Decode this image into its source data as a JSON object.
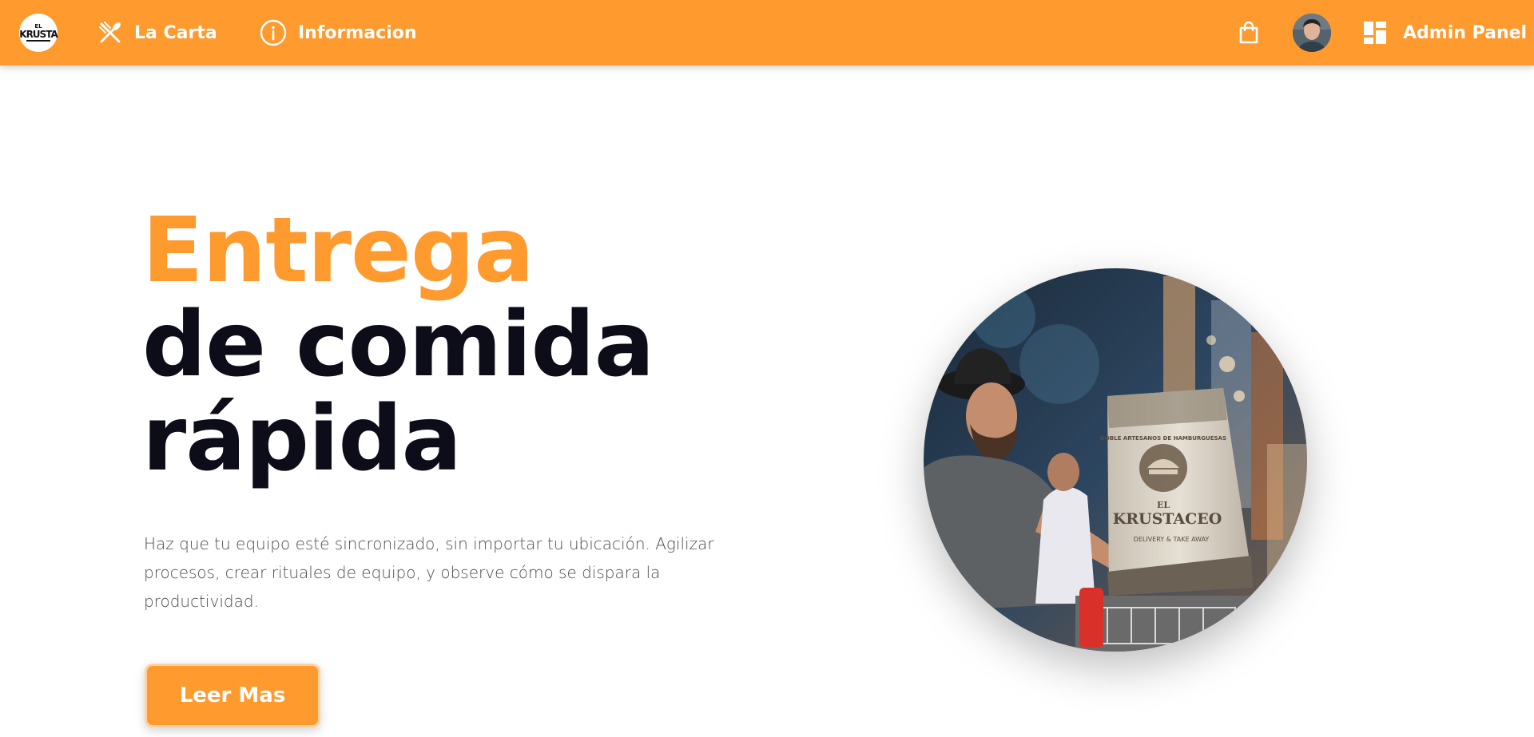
{
  "brand": {
    "logo_top": "EL",
    "logo_main": "KRUSTA"
  },
  "nav": {
    "carta_label": "La Carta",
    "info_label": "Informacion",
    "admin_label": "Admin Panel"
  },
  "icons": {
    "carta": "fork-knife-icon",
    "info": "info-circle-icon",
    "cart": "shopping-bag-icon",
    "admin": "dashboard-icon"
  },
  "hero": {
    "title_accent": "Entrega",
    "title_line2": "de comida",
    "title_line3": "rápida",
    "description": "Haz que tu equipo esté sincronizado, sin importar tu ubicación. Agilizar procesos, crear rituales de equipo, y observe cómo se dispara la productividad.",
    "cta_label": "Leer Mas"
  },
  "photo": {
    "bag_small_text": "DOBLE ARTESANOS DE HAMBURGUESAS",
    "bag_brand_1": "EL",
    "bag_brand_2": "KRUSTACEO",
    "bag_delivery": "DELIVERY & TAKE AWAY"
  },
  "colors": {
    "accent": "#ff9a2e",
    "title_dark": "#0d0d1a",
    "body_text": "#4b4b52"
  }
}
